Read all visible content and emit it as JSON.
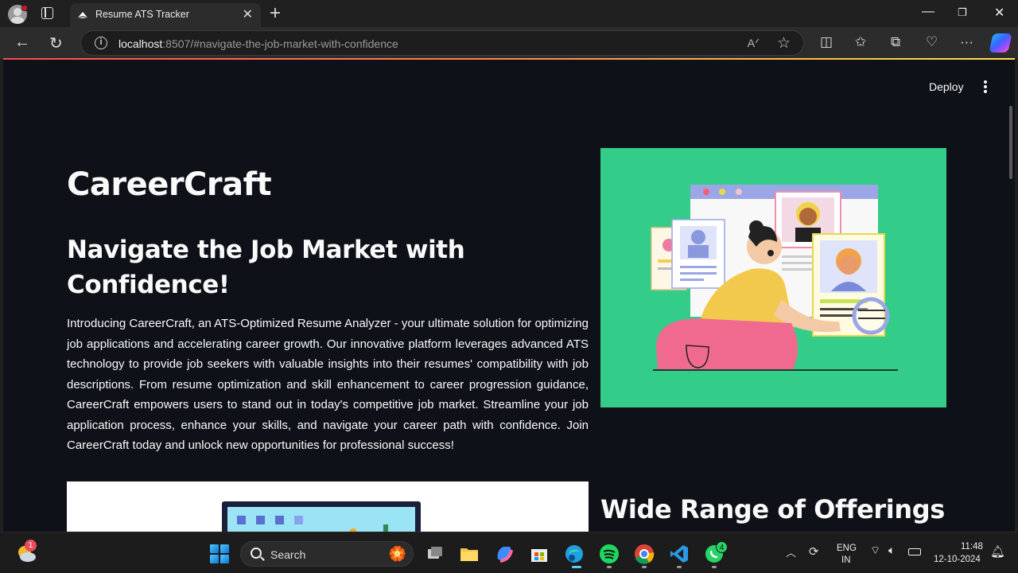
{
  "browser": {
    "tab_title": "Resume ATS Tracker",
    "url_host": "localhost",
    "url_rest": ":8507/#navigate-the-job-market-with-confidence"
  },
  "app": {
    "deploy_label": "Deploy",
    "title": "CareerCraft",
    "hero_heading": "Navigate the Job Market with Confidence!",
    "intro": "Introducing CareerCraft, an ATS-Optimized Resume Analyzer - your ultimate solution for optimizing job applications and accelerating career growth. Our innovative platform leverages advanced ATS technology to provide job seekers with valuable insights into their resumes' compatibility with job descriptions. From resume optimization and skill enhancement to career progression guidance, CareerCraft empowers users to stand out in today's competitive job market. Streamline your job application process, enhance your skills, and navigate your career path with confidence. Join CareerCraft today and unlock new opportunities for professional success!",
    "offerings_heading": "Wide Range of Offerings"
  },
  "taskbar": {
    "weather_badge": "1",
    "search_label": "Search",
    "whatsapp_badge": "4",
    "lang_line1": "ENG",
    "lang_line2": "IN",
    "time": "11:48",
    "date": "12-10-2024"
  },
  "colors": {
    "page_bg": "#0e1117",
    "hero_image_bg": "#33cc88",
    "accent_progress": "#ff4b4b"
  }
}
